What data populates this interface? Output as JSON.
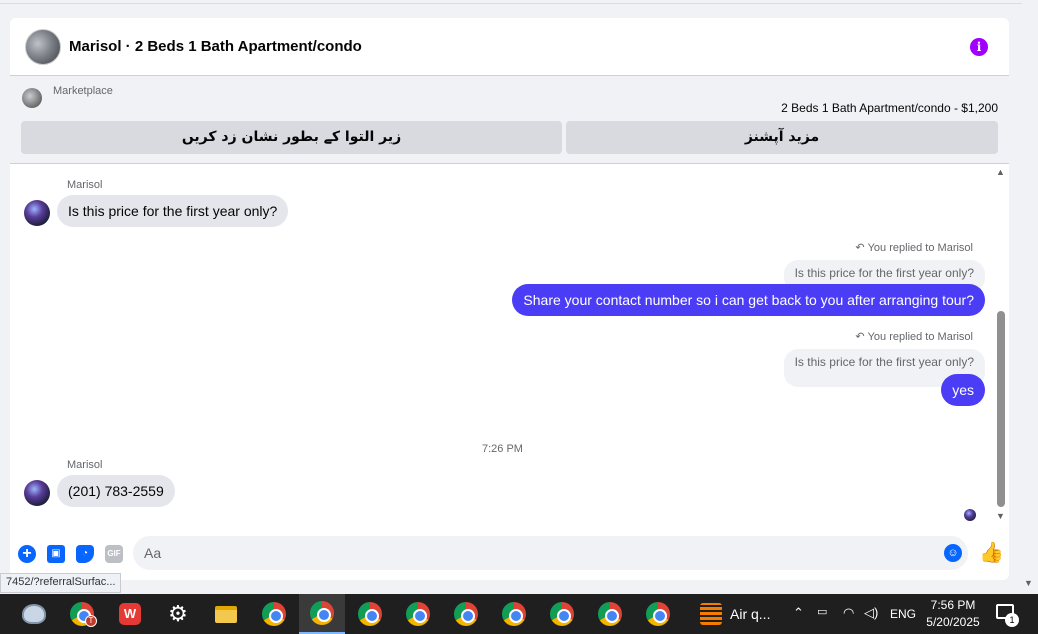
{
  "header": {
    "title": "Marisol · 2 Beds 1 Bath Apartment/condo"
  },
  "marketplace": {
    "label": "Marketplace",
    "listing": "2 Beds 1 Bath Apartment/condo - $1,200",
    "btn_mark_pending": "زیر التوا کے بطور نشان زد کریں",
    "btn_more_options": "مزید آپشنز"
  },
  "messages": {
    "msg1": {
      "sender": "Marisol",
      "text": "Is this price for the first year only?"
    },
    "reply1": {
      "note": "You replied to Marisol",
      "quoted": "Is this price for the first year only?",
      "text": "Share your contact number so i can get back to you after arranging tour?"
    },
    "reply2": {
      "note": "You replied to Marisol",
      "quoted": "Is this price for the first year only?",
      "text": "yes"
    },
    "timestamp": "7:26 PM",
    "msg2": {
      "sender": "Marisol",
      "text": "(201) 783-2559"
    }
  },
  "composer": {
    "placeholder": "Aa"
  },
  "status_bar": {
    "url": "7452/?referralSurfac..."
  },
  "taskbar": {
    "app_label": "Air q...",
    "lang": "ENG",
    "time": "7:56 PM",
    "date": "5/20/2025",
    "notification_count": "1",
    "chrome_badge": "T"
  },
  "colors": {
    "outgoing_bubble": "#4b3df5",
    "incoming_bubble": "#e4e6eb",
    "accent": "#0866ff",
    "info": "#a100ff"
  }
}
